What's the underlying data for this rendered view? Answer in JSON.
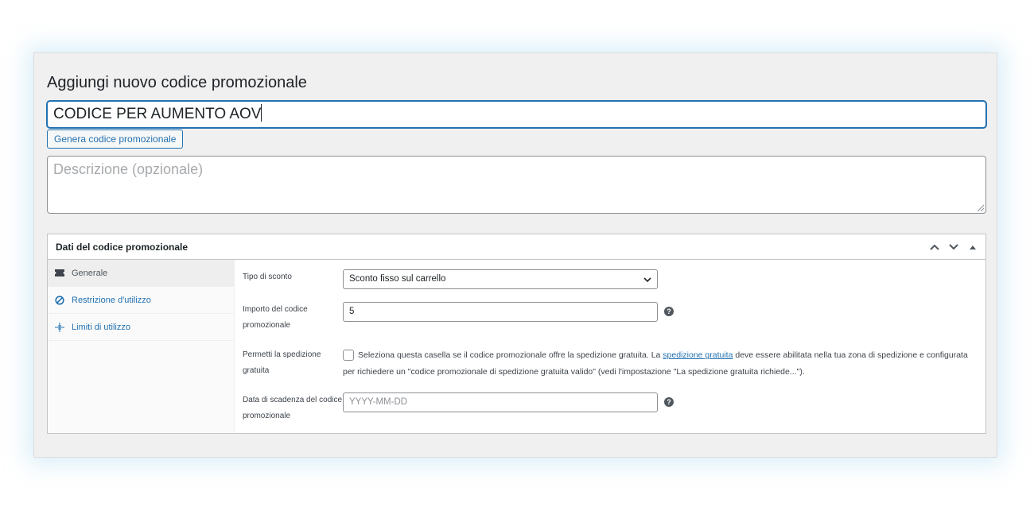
{
  "page": {
    "title": "Aggiungi nuovo codice promozionale",
    "code_value": "CODICE PER AUMENTO AOV",
    "generate_button": "Genera codice promozionale",
    "description_placeholder": "Descrizione (opzionale)"
  },
  "coupon_data": {
    "title": "Dati del codice promozionale",
    "tabs": [
      {
        "label": "Generale",
        "icon": "ticket-icon",
        "active": true
      },
      {
        "label": "Restrizione d'utilizzo",
        "icon": "block-icon",
        "active": false
      },
      {
        "label": "Limiti di utilizzo",
        "icon": "plus-crosshair-icon",
        "active": false
      }
    ],
    "fields": {
      "discount_type": {
        "label": "Tipo di sconto",
        "value": "Sconto fisso sul carrello"
      },
      "amount": {
        "label": "Importo del codice promozionale",
        "value": "5"
      },
      "free_shipping": {
        "label": "Permetti la spedizione gratuita",
        "text_before": "Seleziona questa casella se il codice promozionale offre la spedizione gratuita. La ",
        "link_text": "spedizione gratuita",
        "text_after": " deve essere abilitata nella tua zona di spedizione e configurata per richiedere un \"codice promozionale di spedizione gratuita valido\" (vedi l'impostazione \"La spedizione gratuita richiede...\").",
        "checked": false
      },
      "expiry_date": {
        "label": "Data di scadenza del codice promozionale",
        "placeholder": "YYYY-MM-DD"
      }
    }
  },
  "colors": {
    "accent": "#2271b1",
    "frame_bg": "#f0f0f1",
    "border": "#c3c4c7"
  }
}
